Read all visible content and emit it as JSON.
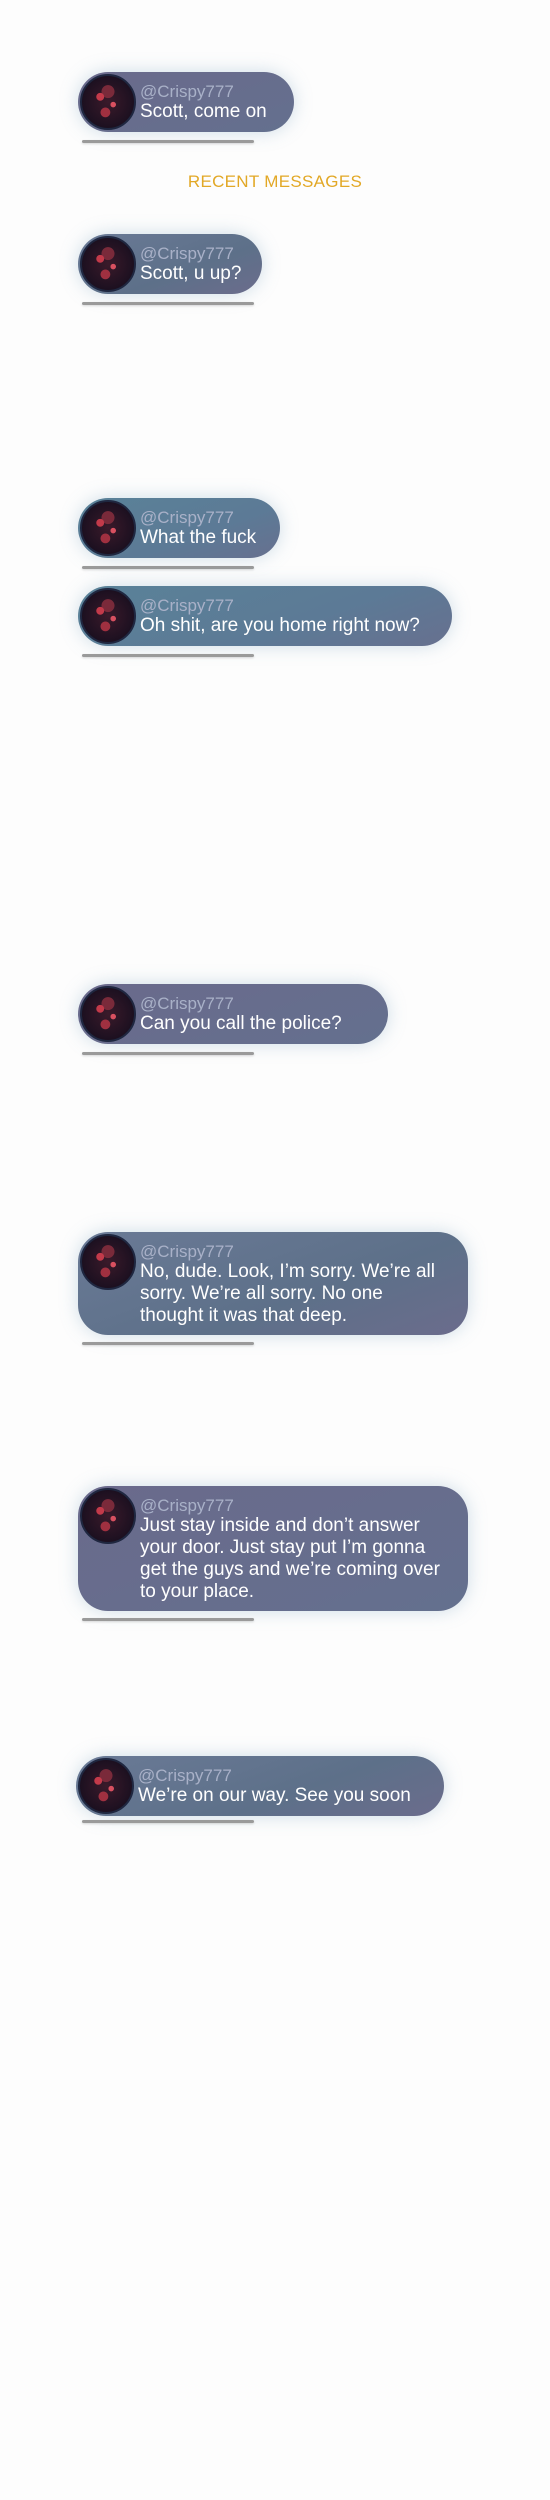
{
  "section_title": "RECENT MESSAGES",
  "messages": [
    {
      "handle": "@Crispy777",
      "text": "Scott, come on"
    },
    {
      "handle": "@Crispy777",
      "text": "Scott, u up?"
    },
    {
      "handle": "@Crispy777",
      "text": "What the fuck"
    },
    {
      "handle": "@Crispy777",
      "text": "Oh shit, are you home right now?"
    },
    {
      "handle": "@Crispy777",
      "text": "Can you call the police?"
    },
    {
      "handle": "@Crispy777",
      "text": "No, dude. Look, I’m sorry. We’re all sorry. We’re all sorry. No one thought it was that deep."
    },
    {
      "handle": "@Crispy777",
      "text": "Just stay inside and don’t answer your door. Just stay put I’m gonna get the guys and we’re coming over to your place."
    },
    {
      "handle": "@Crispy777",
      "text": "We’re on our way. See you soon"
    }
  ]
}
